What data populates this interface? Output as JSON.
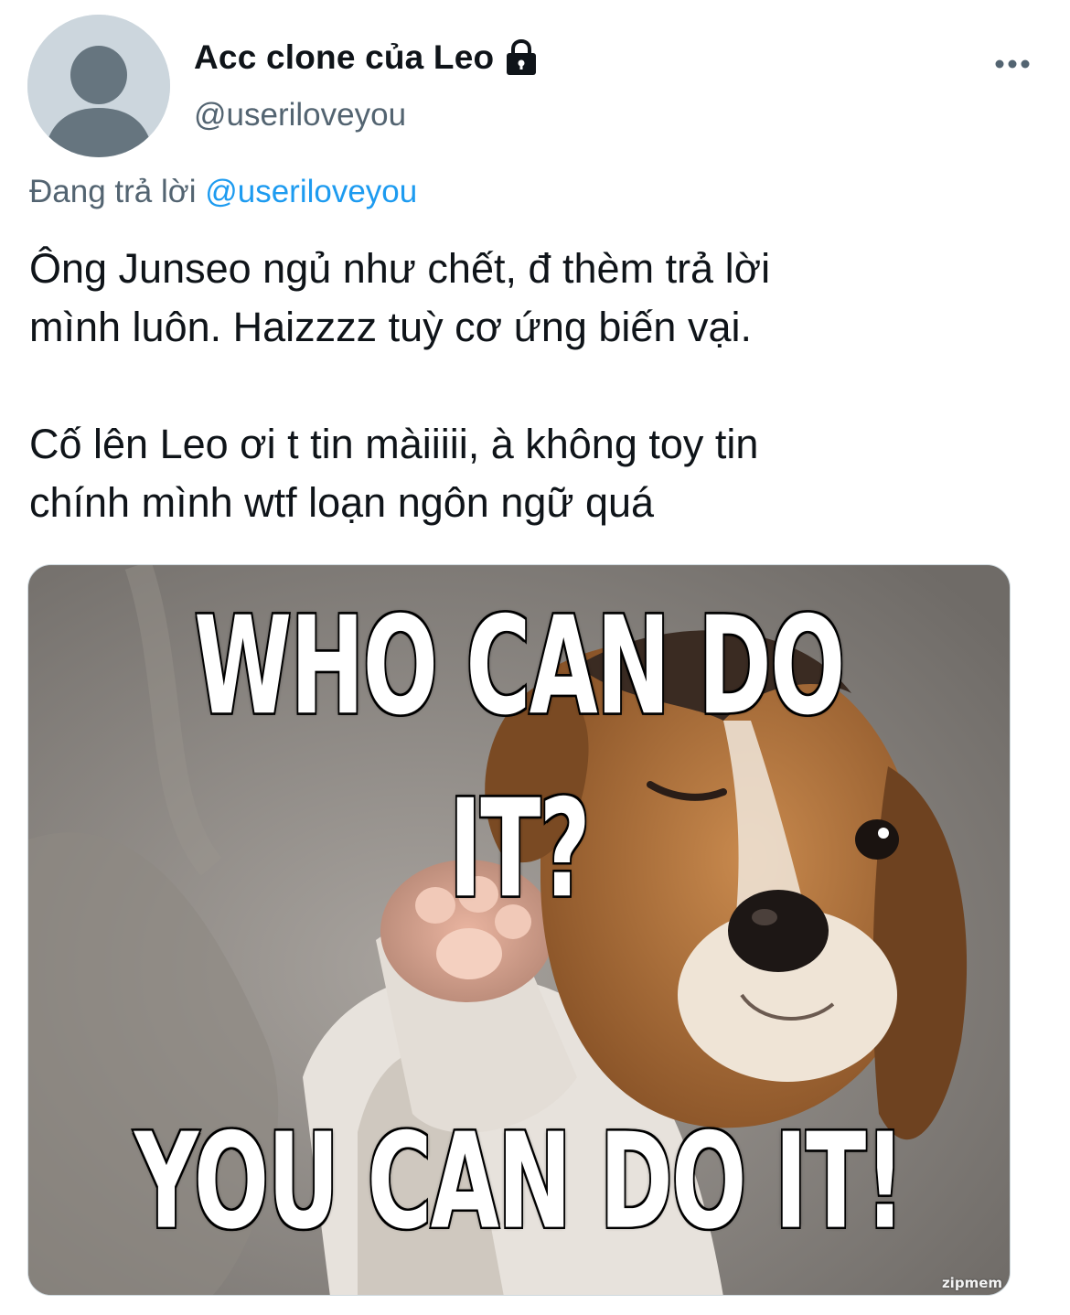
{
  "author": {
    "display_name": "Acc clone của Leo",
    "handle": "@useriloveyou",
    "protected_icon": "lock-icon",
    "avatar": "default-avatar"
  },
  "more_icon": "more-horizontal-icon",
  "reply": {
    "prefix": "Đang trả lời",
    "target": "@useriloveyou"
  },
  "tweet": {
    "text": "Ông Junseo ngủ như chết, đ thèm trả lời\nmình luôn. Haizzzz tuỳ cơ ứng biến vại.\n\nCố lên Leo ơi t tin màiiiii, à không toy tin\nchính mình wtf loạn ngôn ngữ quá"
  },
  "media": {
    "top_caption": "WHO CAN DO IT?",
    "bottom_caption": "YOU CAN DO IT!",
    "watermark": "zipmem"
  },
  "colors": {
    "text_primary": "#0f1419",
    "text_secondary": "#536471",
    "link": "#1d9bf0",
    "avatar_bg": "#ccd6dd"
  }
}
